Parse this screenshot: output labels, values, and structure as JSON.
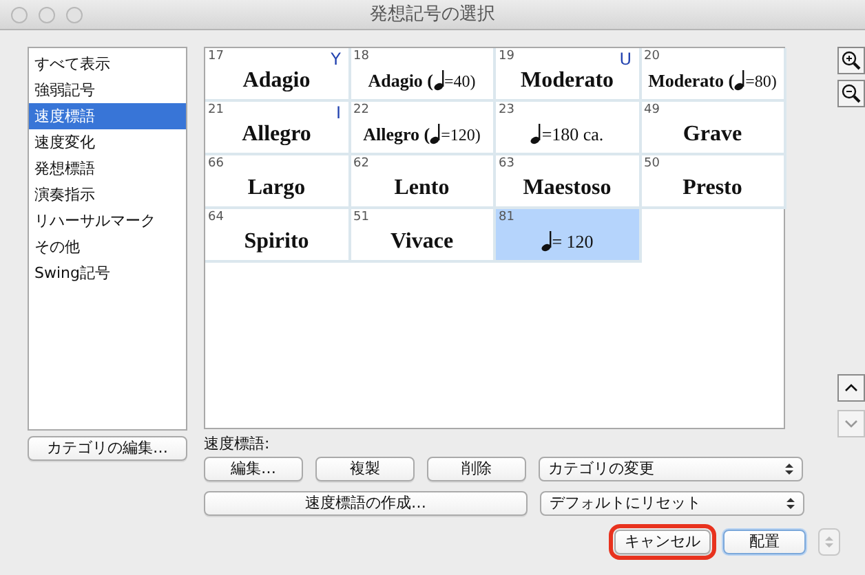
{
  "window": {
    "title": "発想記号の選択"
  },
  "categories": [
    {
      "label": "すべて表示",
      "selected": false
    },
    {
      "label": "強弱記号",
      "selected": false
    },
    {
      "label": "速度標語",
      "selected": true
    },
    {
      "label": "速度変化",
      "selected": false
    },
    {
      "label": "発想標語",
      "selected": false
    },
    {
      "label": "演奏指示",
      "selected": false
    },
    {
      "label": "リハーサルマーク",
      "selected": false
    },
    {
      "label": "その他",
      "selected": false
    },
    {
      "label": "Swing記号",
      "selected": false
    }
  ],
  "edit_categories_button": "カテゴリの編集…",
  "cells": [
    {
      "number": "17",
      "shortcut": "Y",
      "text": "Adagio",
      "selected": false
    },
    {
      "number": "18",
      "text": "Adagio (",
      "note": true,
      "after": "=40)",
      "selected": false
    },
    {
      "number": "19",
      "shortcut": "U",
      "text": "Moderato",
      "selected": false
    },
    {
      "number": "20",
      "text": "Moderato (",
      "note": true,
      "after": "=80)",
      "selected": false
    },
    {
      "number": "21",
      "shortcut": "I",
      "text": "Allegro",
      "selected": false
    },
    {
      "number": "22",
      "text": "Allegro (",
      "note": true,
      "after": "=120)",
      "selected": false
    },
    {
      "number": "23",
      "note": true,
      "after": "=180 ca.",
      "selected": false
    },
    {
      "number": "49",
      "text": "Grave",
      "selected": false
    },
    {
      "number": "66",
      "text": "Largo",
      "selected": false
    },
    {
      "number": "62",
      "text": "Lento",
      "selected": false
    },
    {
      "number": "63",
      "text": "Maestoso",
      "selected": false
    },
    {
      "number": "50",
      "text": "Presto",
      "selected": false
    },
    {
      "number": "64",
      "text": "Spirito",
      "selected": false
    },
    {
      "number": "51",
      "text": "Vivace",
      "selected": false
    },
    {
      "number": "81",
      "note": true,
      "after": "= 120",
      "selected": true
    }
  ],
  "section_label": "速度標語:",
  "buttons": [
    {
      "label": "編集…"
    },
    {
      "label": "複製"
    },
    {
      "label": "削除"
    }
  ],
  "change_category_select": "カテゴリの変更",
  "create_button": "速度標語の作成…",
  "reset_select": "デフォルトにリセット",
  "cancel_button": {
    "label": "キャンセル",
    "highlighted": true
  },
  "place_button": {
    "label": "配置",
    "default": true
  }
}
